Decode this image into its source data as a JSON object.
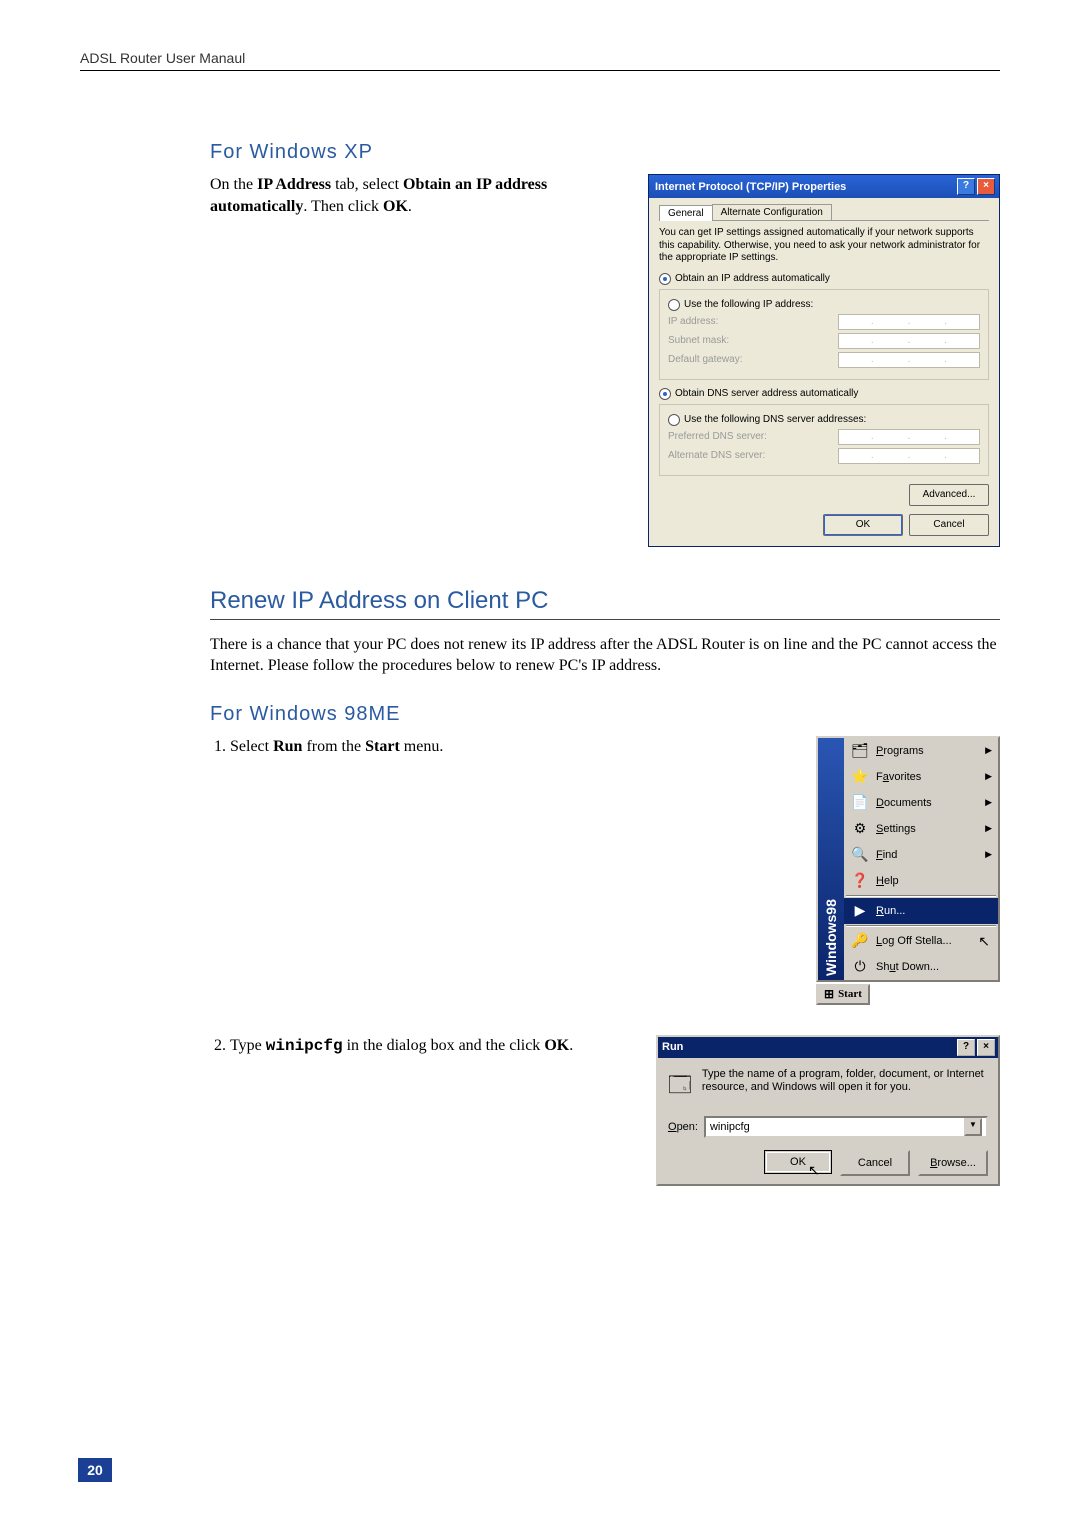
{
  "running_head": "ADSL Router User Manaul",
  "page_number": "20",
  "sections": {
    "winxp": {
      "heading": "For Windows XP",
      "para_pre": "On the ",
      "ip_tab_bold": "IP Address",
      "para_mid1": " tab, select ",
      "obtain_bold": "Obtain an IP address automatically",
      "para_mid2": ". Then click ",
      "ok_bold": "OK",
      "para_end": "."
    },
    "renew": {
      "heading": "Renew IP Address on Client PC",
      "para": "There is a chance that your PC does not renew its IP address after the ADSL Router is on line and the PC cannot access the Internet. Please follow the procedures below to renew PC's IP address."
    },
    "win98": {
      "heading": "For Windows 98ME",
      "step1_pre": "Select ",
      "step1_run": "Run",
      "step1_mid": " from the ",
      "step1_start": "Start",
      "step1_end": " menu.",
      "step2_pre": "Type ",
      "step2_cmd": "winipcfg",
      "step2_mid": " in the dialog box and the click ",
      "step2_ok": "OK",
      "step2_end": "."
    }
  },
  "tcpip_dialog": {
    "title": "Internet Protocol (TCP/IP) Properties",
    "help_btn": "?",
    "close_btn": "×",
    "tabs": {
      "general": "General",
      "alt": "Alternate Configuration"
    },
    "info": "You can get IP settings assigned automatically if your network supports this capability. Otherwise, you need to ask your network administrator for the appropriate IP settings.",
    "radio_auto_ip": "Obtain an IP address automatically",
    "radio_manual_ip": "Use the following IP address:",
    "lbl_ip": "IP address:",
    "lbl_mask": "Subnet mask:",
    "lbl_gw": "Default gateway:",
    "radio_auto_dns": "Obtain DNS server address automatically",
    "radio_manual_dns": "Use the following DNS server addresses:",
    "lbl_pref_dns": "Preferred DNS server:",
    "lbl_alt_dns": "Alternate DNS server:",
    "btn_adv": "Advanced...",
    "btn_ok": "OK",
    "btn_cancel": "Cancel"
  },
  "start_menu": {
    "side_label": "Windows98",
    "items": {
      "programs": "Programs",
      "favorites": "Favorites",
      "documents": "Documents",
      "settings": "Settings",
      "find": "Find",
      "help": "Help",
      "run": "Run...",
      "logoff": "Log Off Stella...",
      "shutdown": "Shut Down..."
    },
    "start_label": "Start"
  },
  "run_dialog": {
    "title": "Run",
    "help_btn": "?",
    "close_btn": "×",
    "desc": "Type the name of a program, folder, document, or Internet resource, and Windows will open it for you.",
    "open_label": "Open:",
    "open_value": "winipcfg",
    "btn_ok": "OK",
    "btn_cancel": "Cancel",
    "btn_browse": "Browse..."
  }
}
